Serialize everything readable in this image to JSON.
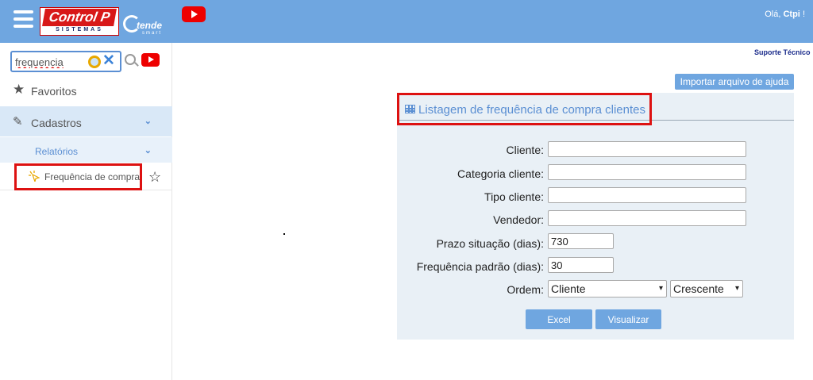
{
  "header": {
    "logo_main": "Control P",
    "logo_sub": "SISTEMAS",
    "atende_text": "tende",
    "atende_sub": "smart",
    "greeting_prefix": "Olá,",
    "user_name": "Ctpi",
    "greeting_suffix": "!",
    "brand_color": "#6fa6e0"
  },
  "sidebar": {
    "search": {
      "value": "frequencia",
      "placeholder": ""
    },
    "favorites_label": "Favoritos",
    "cadastros_label": "Cadastros",
    "relatorios_label": "Relatórios",
    "selected_item_label": "Frequência de compra",
    "chevron": "⌄"
  },
  "main": {
    "support_link": "Suporte Técnico",
    "help_button": "Importar arquivo de ajuda",
    "panel_title": "Listagem de frequência de compra clientes",
    "form": {
      "cliente_label": "Cliente:",
      "cliente_value": "",
      "categoria_label": "Categoria cliente:",
      "categoria_value": "",
      "tipo_label": "Tipo cliente:",
      "tipo_value": "",
      "vendedor_label": "Vendedor:",
      "vendedor_value": "",
      "prazo_label": "Prazo situação (dias):",
      "prazo_value": "730",
      "frequencia_label": "Frequência padrão (dias):",
      "frequencia_value": "30",
      "ordem_label": "Ordem:",
      "ordem_value": "Cliente",
      "direcao_value": "Crescente"
    },
    "buttons": {
      "excel": "Excel",
      "visualizar": "Visualizar"
    }
  }
}
